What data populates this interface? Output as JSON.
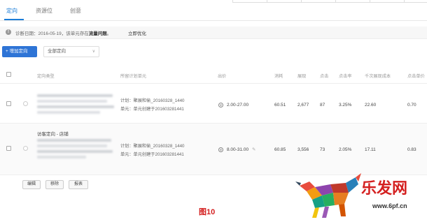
{
  "tabs": [
    {
      "label": "定向",
      "active": true
    },
    {
      "label": "资源位",
      "active": false
    },
    {
      "label": "创意",
      "active": false
    }
  ],
  "notice": {
    "text": "诊断日期：2016-05-19，该单元存在",
    "highlight": "流量问题",
    "suffix": "。",
    "link": "立即优化"
  },
  "toolbar": {
    "add_label": "+ 增加定向",
    "filter_value": "全部定向",
    "filter_chevron": "∨"
  },
  "table": {
    "headers": [
      "定向类型",
      "所留计划单元",
      "出价",
      "消耗",
      "展现",
      "点击",
      "点击率",
      "千次展现成本",
      "点击单价"
    ],
    "rows": [
      {
        "title": "",
        "plan_line1": "计划：聚展和偷_20160328_1440",
        "plan_line2": "单元：单元创建于201603281441",
        "bid": "2.00-27.00",
        "cost": "60.51",
        "impressions": "2,677",
        "clicks": "87",
        "ctr": "3.25%",
        "cpm": "22.60",
        "cpc": "0.70"
      },
      {
        "title": "访客定向 - 店铺",
        "plan_line1": "计划：聚展和偷_20160328_1440",
        "plan_line2": "单元：单元创建于201603281441",
        "bid": "8.00-31.00",
        "cost": "60.85",
        "impressions": "3,556",
        "clicks": "73",
        "ctr": "2.05%",
        "cpm": "17.11",
        "cpc": "0.83"
      }
    ]
  },
  "actions": [
    "编辑",
    "移除",
    "报表"
  ],
  "caption": "图10",
  "logo": {
    "brand": "乐发网",
    "url": "www.6pf.cn"
  },
  "icons": {
    "bid": "¥",
    "edit": "✎",
    "info": "!"
  },
  "colors": {
    "accent": "#1a7cd8",
    "button": "#2e74d6",
    "caption": "#d42020"
  }
}
